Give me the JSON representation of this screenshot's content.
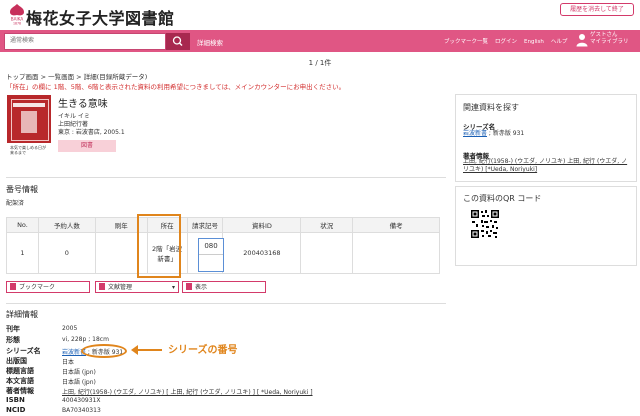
{
  "header": {
    "site_title": "梅花女子大学図書館",
    "logo_text": "BAIKA",
    "logo_year": "1878",
    "history_button": "履歴を消去して終了"
  },
  "navbar": {
    "search_placeholder": "通常検索",
    "advanced_search": "詳細検索",
    "links": [
      "ブックマーク一覧",
      "ログイン",
      "English",
      "ヘルプ"
    ],
    "guest_line1": "ゲストさん",
    "guest_line2": "マイライブラリ"
  },
  "page_count": "1 / 1件",
  "breadcrumb": "トップ画面 > 一覧画面 > 詳細(目録所蔵データ)",
  "notice": "「所在」の欄に 1階、5階、6階と表示された資料の利用希望につきましては、メインカウンターにお申出ください。",
  "record": {
    "cover_text": "本気で楽しめる日が来るまで",
    "title": "生きる意味",
    "author_kana": "イキル イミ",
    "author": "上田紀行著",
    "publisher": "東京 : 岩波書店, 2005.1",
    "type_badge": "図書"
  },
  "holdings": {
    "section_title": "番号情報",
    "subtitle": "配架済",
    "headers": [
      "No.",
      "予約人数",
      "刷年",
      "所在",
      "請求記号",
      "資料ID",
      "状況",
      "備考"
    ],
    "row": {
      "no": "1",
      "reservations": "0",
      "print_year": "",
      "location": "2階「岩波新書」",
      "call_number": "080",
      "item_id": "200403168",
      "status": "",
      "remarks": ""
    }
  },
  "actions": {
    "bookmark": "ブックマーク",
    "bibliography": "文献管理",
    "print": "表示"
  },
  "details": {
    "section_title": "詳細情報",
    "fields": [
      {
        "label": "刊年",
        "value": "2005"
      },
      {
        "label": "形態",
        "value": "vi, 228p ; 18cm"
      },
      {
        "label": "シリーズ名",
        "value": "岩波新書 ; 新赤版 931"
      },
      {
        "label": "出版国",
        "value": "日本"
      },
      {
        "label": "標題言語",
        "value": "日本語 (jpn)"
      },
      {
        "label": "本文言語",
        "value": "日本語 (jpn)"
      },
      {
        "label": "著者情報",
        "value": "上田, 紀行(1958-) (ウエダ, ノリユキ) [ 上田, 紀行 (ウエダ, ノリユキ) ] [ *Ueda, Noriyuki ]"
      },
      {
        "label": "ISBN",
        "value": "400430931X"
      },
      {
        "label": "NCID",
        "value": "BA70340313"
      }
    ],
    "series_link": "岩波新書",
    "series_number": "新赤版 931",
    "annotation": "シリーズの番号"
  },
  "side": {
    "related_title": "関連資料を探す",
    "series_label": "シリーズ名",
    "series_link": "岩波新書",
    "series_rest": " ; 新赤版 931",
    "author_label": "著者情報",
    "author_value": "上田, 紀行(1958-) (ウエダ, ノリユキ) 上田, 紀行 (ウエダ, ノリユキ) [*Ueda, Noriyuki]",
    "qr_title": "この資料のQR コード"
  },
  "colors": {
    "brand_pink": "#e05684",
    "annotation_orange": "#e0851c",
    "notice_red": "#d33030"
  }
}
